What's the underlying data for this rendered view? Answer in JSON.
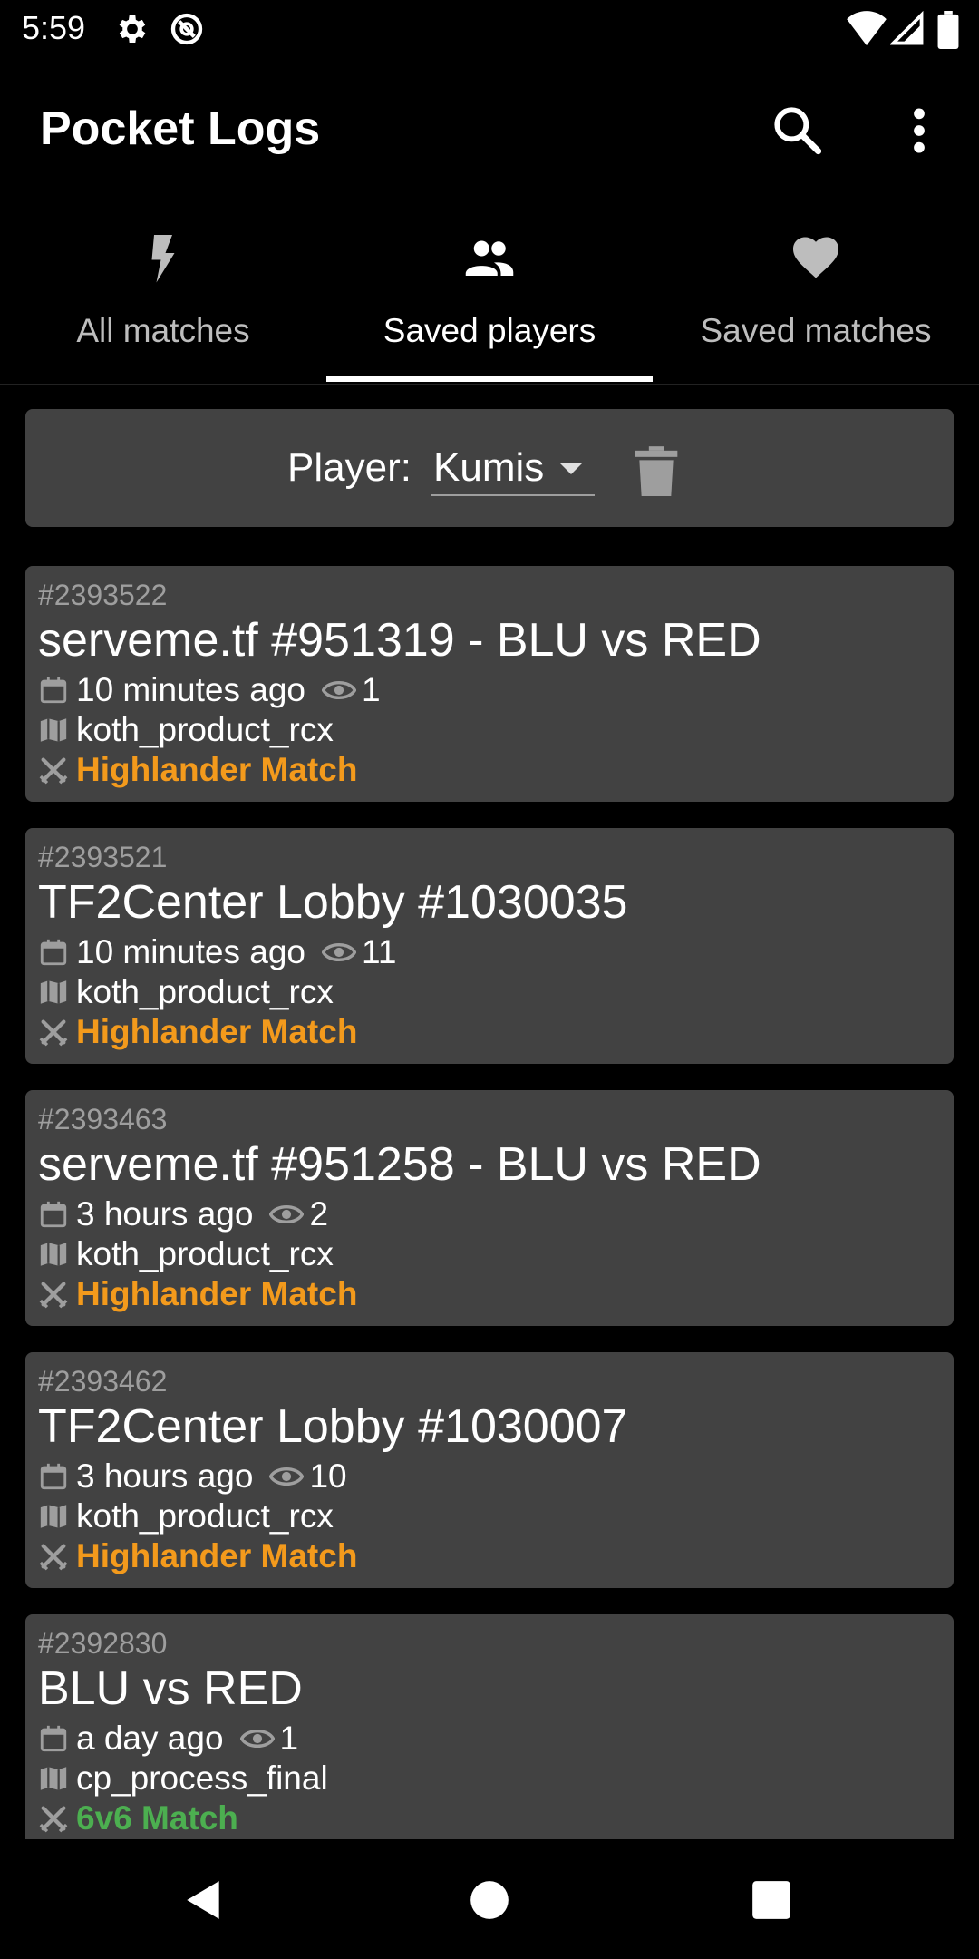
{
  "status_bar": {
    "time": "5:59"
  },
  "app": {
    "title": "Pocket Logs"
  },
  "tabs": [
    {
      "label": "All matches",
      "icon": "lightning-icon",
      "active": false
    },
    {
      "label": "Saved players",
      "icon": "people-icon",
      "active": true
    },
    {
      "label": "Saved matches",
      "icon": "heart-icon",
      "active": false
    }
  ],
  "player_filter": {
    "label": "Player:",
    "selected": "Kumis"
  },
  "matches": [
    {
      "id": "#2393522",
      "title": "serveme.tf #951319 - BLU vs RED",
      "time": "10 minutes ago",
      "views": "1",
      "map": "koth_product_rcx",
      "type": "Highlander Match"
    },
    {
      "id": "#2393521",
      "title": "TF2Center Lobby #1030035",
      "time": "10 minutes ago",
      "views": "11",
      "map": "koth_product_rcx",
      "type": "Highlander Match"
    },
    {
      "id": "#2393463",
      "title": "serveme.tf #951258 - BLU vs RED",
      "time": "3 hours ago",
      "views": "2",
      "map": "koth_product_rcx",
      "type": "Highlander Match"
    },
    {
      "id": "#2393462",
      "title": "TF2Center Lobby #1030007",
      "time": "3 hours ago",
      "views": "10",
      "map": "koth_product_rcx",
      "type": "Highlander Match"
    },
    {
      "id": "#2392830",
      "title": "BLU vs RED",
      "time": "a day ago",
      "views": "1",
      "map": "cp_process_final",
      "type": "6v6 Match"
    }
  ],
  "colors": {
    "highlander": "#f39a1c",
    "sixes": "#4caf50",
    "card": "#424242"
  }
}
